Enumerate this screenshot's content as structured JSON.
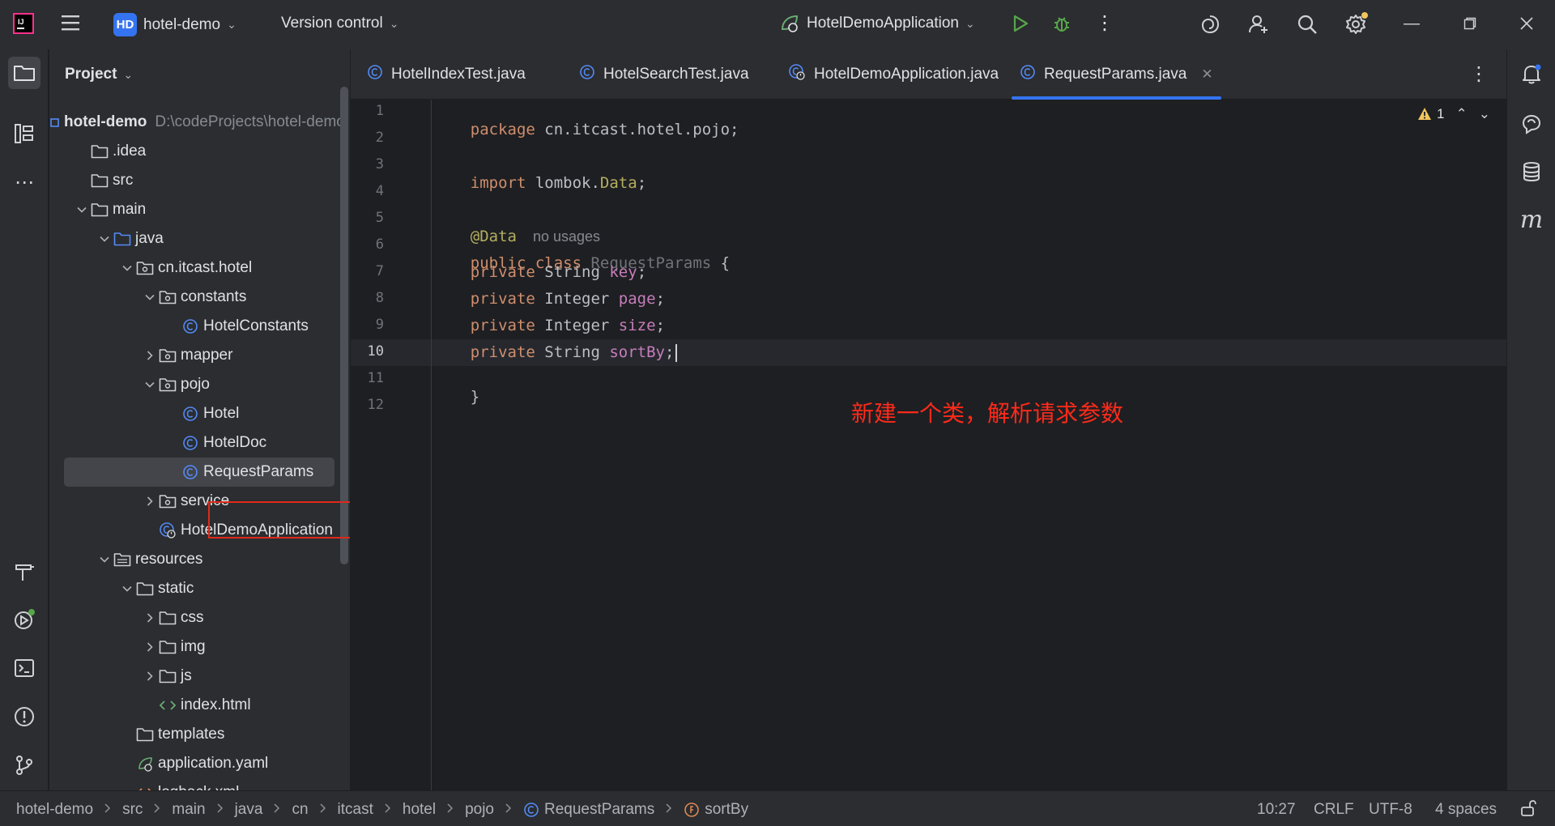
{
  "titlebar": {
    "project_badge": "HD",
    "project_name": "hotel-demo",
    "version_control": "Version control",
    "run_config": "HotelDemoApplication"
  },
  "project_panel": {
    "title": "Project",
    "tree": [
      {
        "label": "hotel-demo",
        "path": "D:\\codeProjects\\hotel-demo",
        "level": 0,
        "icon": "module-icon",
        "chevron": ""
      },
      {
        "label": ".idea",
        "level": 1,
        "icon": "folder-icon",
        "chevron": ""
      },
      {
        "label": "src",
        "level": 1,
        "icon": "folder-icon",
        "chevron": ""
      },
      {
        "label": "main",
        "level": 1,
        "icon": "folder-icon",
        "chevron": "down"
      },
      {
        "label": "java",
        "level": 2,
        "icon": "source-folder-icon",
        "chevron": "down"
      },
      {
        "label": "cn.itcast.hotel",
        "level": 3,
        "icon": "package-icon",
        "chevron": "down"
      },
      {
        "label": "constants",
        "level": 4,
        "icon": "package-icon",
        "chevron": "down"
      },
      {
        "label": "HotelConstants",
        "level": 5,
        "icon": "class-icon",
        "chevron": ""
      },
      {
        "label": "mapper",
        "level": 4,
        "icon": "package-icon",
        "chevron": "right"
      },
      {
        "label": "pojo",
        "level": 4,
        "icon": "package-icon",
        "chevron": "down"
      },
      {
        "label": "Hotel",
        "level": 5,
        "icon": "class-icon",
        "chevron": ""
      },
      {
        "label": "HotelDoc",
        "level": 5,
        "icon": "class-icon",
        "chevron": ""
      },
      {
        "label": "RequestParams",
        "level": 5,
        "icon": "class-icon",
        "chevron": "",
        "selected": true
      },
      {
        "label": "service",
        "level": 4,
        "icon": "package-icon",
        "chevron": "right"
      },
      {
        "label": "HotelDemoApplication",
        "level": 4,
        "icon": "spring-class-icon",
        "chevron": ""
      },
      {
        "label": "resources",
        "level": 2,
        "icon": "resources-folder-icon",
        "chevron": "down"
      },
      {
        "label": "static",
        "level": 3,
        "icon": "folder-icon",
        "chevron": "down"
      },
      {
        "label": "css",
        "level": 4,
        "icon": "folder-icon",
        "chevron": "right"
      },
      {
        "label": "img",
        "level": 4,
        "icon": "folder-icon",
        "chevron": "right"
      },
      {
        "label": "js",
        "level": 4,
        "icon": "folder-icon",
        "chevron": "right"
      },
      {
        "label": "index.html",
        "level": 4,
        "icon": "html-file-icon",
        "chevron": ""
      },
      {
        "label": "templates",
        "level": 3,
        "icon": "folder-icon",
        "chevron": ""
      },
      {
        "label": "application.yaml",
        "level": 3,
        "icon": "yaml-file-icon",
        "chevron": ""
      },
      {
        "label": "logback.xml",
        "level": 3,
        "icon": "xml-file-icon",
        "chevron": ""
      }
    ]
  },
  "tabs": [
    {
      "label": "HotelIndexTest.java"
    },
    {
      "label": "HotelSearchTest.java"
    },
    {
      "label": "HotelDemoApplication.java"
    },
    {
      "label": "RequestParams.java",
      "active": true
    }
  ],
  "editor": {
    "line_numbers": [
      "1",
      "2",
      "3",
      "4",
      "5",
      "6",
      "7",
      "8",
      "9",
      "10",
      "11",
      "12"
    ],
    "current_line": "10",
    "warning_count": "1",
    "no_usages_hint": "no usages",
    "annotation_note": "新建一个类，解析请求参数",
    "code": {
      "l1_kw": "package",
      "l1_rest": " cn.itcast.hotel.pojo;",
      "l3_kw": "import",
      "l3_a": " lombok.",
      "l3_b": "Data",
      "l3_c": ";",
      "l5_ann": "@Data",
      "l6_kw": "public class",
      "l6_cls": " RequestParams",
      "l6_rest": " {",
      "fields": [
        {
          "type": " String ",
          "name": "key"
        },
        {
          "type": " Integer ",
          "name": "page"
        },
        {
          "type": " Integer ",
          "name": "size"
        },
        {
          "type": " String ",
          "name": "sortBy"
        }
      ],
      "field_kw": "private",
      "semi": ";",
      "l11": "}"
    }
  },
  "statusbar": {
    "breadcrumbs": [
      "hotel-demo",
      "src",
      "main",
      "java",
      "cn",
      "itcast",
      "hotel",
      "pojo",
      "RequestParams",
      "sortBy"
    ],
    "position": "10:27",
    "line_ending": "CRLF",
    "encoding": "UTF-8",
    "indent": "4 spaces"
  },
  "colors": {
    "accent": "#3574f0",
    "highlight_box": "#e02a1b",
    "annotation_text": "#ff2a1a"
  }
}
